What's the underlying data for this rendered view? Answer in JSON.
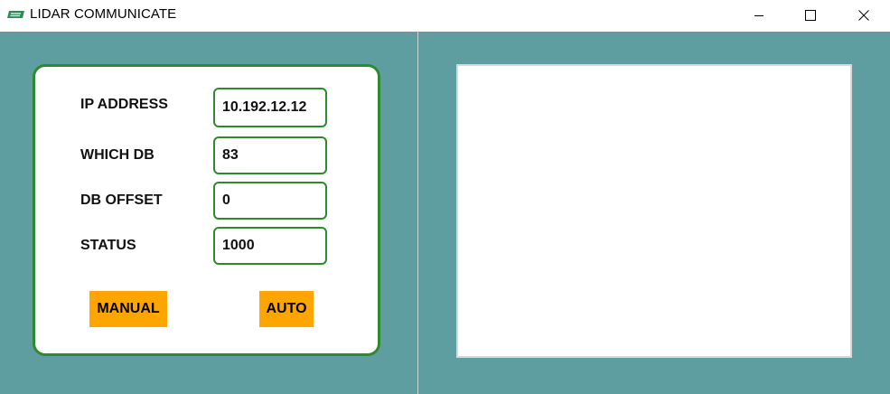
{
  "window": {
    "title": "LIDAR COMMUNICATE",
    "icons": {
      "app": "app-logo-icon",
      "minimize": "minimize-icon",
      "maximize": "maximize-icon",
      "close": "close-icon"
    }
  },
  "form": {
    "ip_label": "IP ADDRESS",
    "ip_value": "10.192.12.12",
    "db_label": "WHICH DB",
    "db_value": "83",
    "offset_label": "DB OFFSET",
    "offset_value": "0",
    "status_label": "STATUS",
    "status_value": "1000"
  },
  "buttons": {
    "manual": "MANUAL",
    "auto": "AUTO"
  },
  "colors": {
    "background": "#5f9ea0",
    "card_border": "#2f8a2f",
    "button": "#ffa500"
  }
}
